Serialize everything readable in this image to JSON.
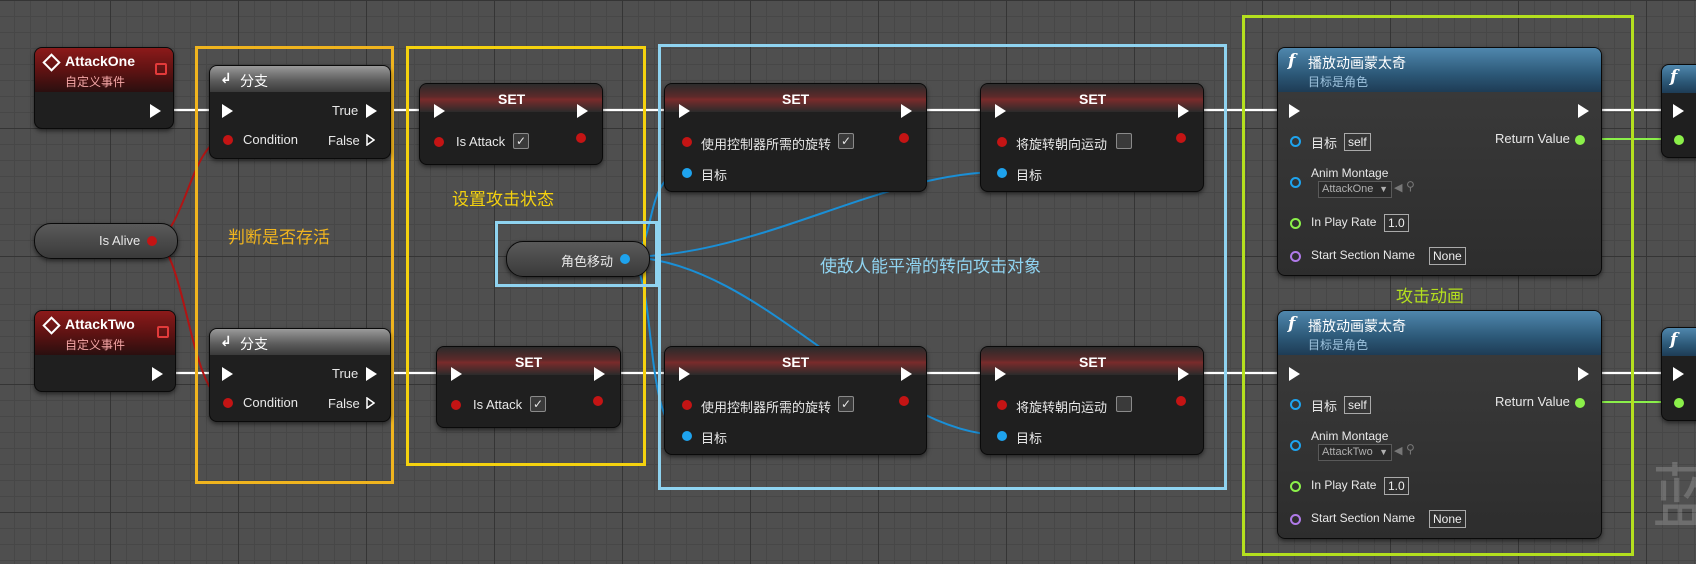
{
  "colors": {
    "exec": "#ffffff",
    "bool": "#c41414",
    "object": "#1ea3ee",
    "float": "#8bf04a",
    "name": "#b07ae8",
    "region_yellow": "#f5d20e",
    "region_orange": "#f0b41e",
    "region_blue": "#8fd3f0",
    "region_green": "#b4e01e"
  },
  "events": [
    {
      "title": "AttackOne",
      "subtitle": "自定义事件"
    },
    {
      "title": "AttackTwo",
      "subtitle": "自定义事件"
    }
  ],
  "getter": {
    "label": "Is Alive"
  },
  "branch": {
    "title": "分支",
    "true_label": "True",
    "false_label": "False",
    "condition_label": "Condition"
  },
  "set_attack": {
    "title": "SET",
    "var_label": "Is Attack",
    "checked": true
  },
  "set_rotation": {
    "title": "SET",
    "var_label": "使用控制器所需的旋转",
    "target_label": "目标",
    "checked": true
  },
  "set_orient": {
    "title": "SET",
    "var_label": "将旋转朝向运动",
    "target_label": "目标",
    "checked": false
  },
  "movement_getter": {
    "label": "角色移动"
  },
  "montage_nodes": [
    {
      "title": "播放动画蒙太奇",
      "subtitle": "目标是角色",
      "target_label": "目标",
      "target_value": "self",
      "return_label": "Return Value",
      "anim_label": "Anim Montage",
      "anim_value": "AttackOne",
      "rate_label": "In Play Rate",
      "rate_value": "1.0",
      "section_label": "Start Section Name",
      "section_value": "None"
    },
    {
      "title": "播放动画蒙太奇",
      "subtitle": "目标是角色",
      "target_label": "目标",
      "target_value": "self",
      "return_label": "Return Value",
      "anim_label": "Anim Montage",
      "anim_value": "AttackTwo",
      "rate_label": "In Play Rate",
      "rate_value": "1.0",
      "section_label": "Start Section Name",
      "section_value": "None"
    }
  ],
  "comments": {
    "alive": "判断是否存活",
    "attack_state": "设置攻击状态",
    "rotate": "使敌人能平滑的转向攻击对象",
    "anim": "攻击动画"
  },
  "watermark": "蓝"
}
